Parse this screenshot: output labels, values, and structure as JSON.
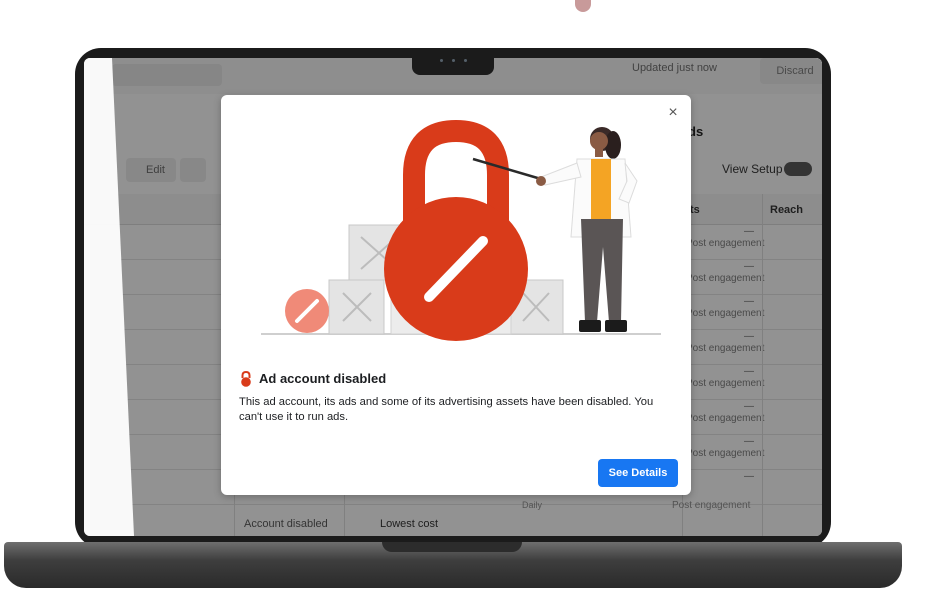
{
  "background_app": {
    "status_text": "Updated just now",
    "discard_label": "Discard",
    "edit_label": "Edit",
    "heading_fragment": "ds",
    "view_setup_label": "View Setup",
    "columns": {
      "results": "ts",
      "reach": "Reach"
    },
    "row_results_text": "Post engagement",
    "row_dash": "—",
    "row_status": "Account disabled",
    "row_bid_strategy": "Lowest cost",
    "row_budget_label": "Daily"
  },
  "modal": {
    "close_label": "×",
    "title": "Ad account disabled",
    "body": "This ad account, its ads and some of its advertising assets have been disabled. You can't use it to run ads.",
    "primary_button_label": "See Details"
  },
  "colors": {
    "primary_button": "#1877f2",
    "lock_red": "#d93b1a",
    "lock_light": "#f08a78",
    "figure_shirt": "#f4a424"
  }
}
